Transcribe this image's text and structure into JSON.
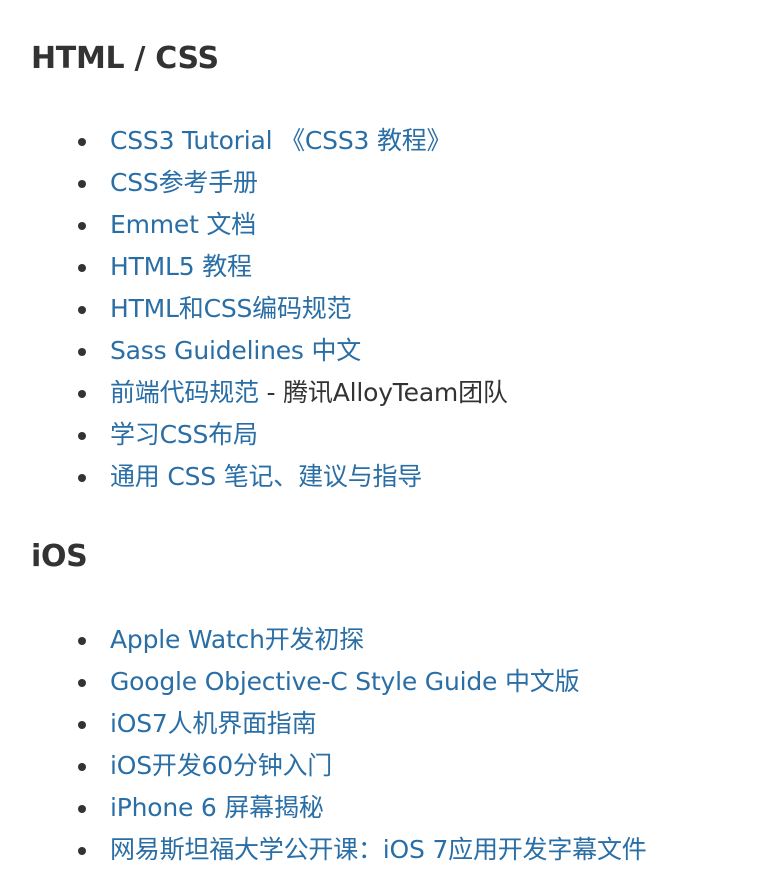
{
  "sections": [
    {
      "heading": "HTML / CSS",
      "items": [
        {
          "link": "CSS3 Tutorial 《CSS3 教程》",
          "suffix": ""
        },
        {
          "link": "CSS参考手册",
          "suffix": ""
        },
        {
          "link": "Emmet 文档",
          "suffix": ""
        },
        {
          "link": "HTML5 教程",
          "suffix": ""
        },
        {
          "link": "HTML和CSS编码规范",
          "suffix": ""
        },
        {
          "link": "Sass Guidelines 中文",
          "suffix": ""
        },
        {
          "link": "前端代码规范",
          "suffix": " - 腾讯AlloyTeam团队"
        },
        {
          "link": "学习CSS布局",
          "suffix": ""
        },
        {
          "link": "通用 CSS 笔记、建议与指导",
          "suffix": ""
        }
      ]
    },
    {
      "heading": "iOS",
      "items": [
        {
          "link": "Apple Watch开发初探",
          "suffix": ""
        },
        {
          "link": "Google Objective-C Style Guide 中文版",
          "suffix": ""
        },
        {
          "link": "iOS7人机界面指南",
          "suffix": ""
        },
        {
          "link": "iOS开发60分钟入门",
          "suffix": ""
        },
        {
          "link": "iPhone 6 屏幕揭秘",
          "suffix": ""
        },
        {
          "link": "网易斯坦福大学公开课：iOS 7应用开发字幕文件",
          "suffix": ""
        }
      ]
    }
  ],
  "colors": {
    "link": "#2a6ea6",
    "text": "#333333",
    "background": "#ffffff"
  }
}
